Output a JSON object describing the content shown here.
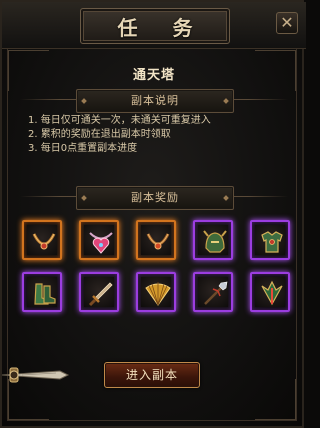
{
  "window": {
    "title": "任 务",
    "close_glyph": "✕"
  },
  "dungeon": {
    "name": "通天塔"
  },
  "description": {
    "header": "副本说明",
    "rules": [
      "1. 每日仅可通关一次，未通关可重复进入",
      "2. 累积的奖励在退出副本时领取",
      "3. 每日0点重置副本进度"
    ]
  },
  "rewards": {
    "header": "副本奖励",
    "items": [
      {
        "quality": "orange",
        "icon": "necklace-icon"
      },
      {
        "quality": "orange",
        "icon": "heart-necklace-icon"
      },
      {
        "quality": "orange",
        "icon": "necklace-icon"
      },
      {
        "quality": "purple",
        "icon": "helmet-icon"
      },
      {
        "quality": "purple",
        "icon": "armor-icon"
      },
      {
        "quality": "purple",
        "icon": "boots-icon"
      },
      {
        "quality": "purple",
        "icon": "sword-icon"
      },
      {
        "quality": "purple",
        "icon": "fan-icon"
      },
      {
        "quality": "purple",
        "icon": "spear-icon"
      },
      {
        "quality": "purple",
        "icon": "wing-blade-icon"
      }
    ]
  },
  "actions": {
    "enter_label": "进入副本"
  },
  "colors": {
    "orange_quality": "#d2741e",
    "purple_quality": "#9b3de0",
    "gold_text": "#d8c09a"
  }
}
